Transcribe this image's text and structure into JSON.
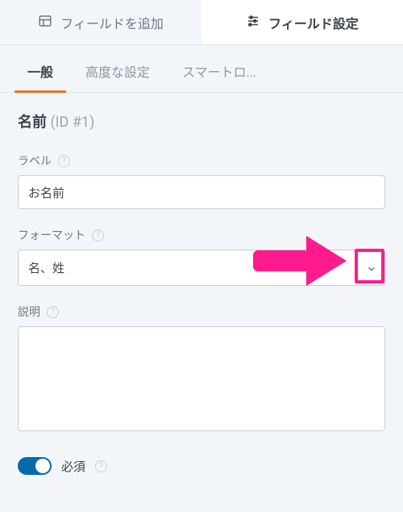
{
  "topTabs": {
    "addField": "フィールドを追加",
    "fieldSettings": "フィールド設定"
  },
  "subTabs": {
    "general": "一般",
    "advanced": "高度な設定",
    "smartLogic": "スマートロ..."
  },
  "field": {
    "title": "名前",
    "idLabel": "(ID #1)"
  },
  "labelSection": {
    "label": "ラベル",
    "value": "お名前"
  },
  "formatSection": {
    "label": "フォーマット",
    "value": "名、姓"
  },
  "descriptionSection": {
    "label": "説明",
    "value": ""
  },
  "requiredSection": {
    "label": "必須"
  },
  "colors": {
    "accent": "#e27730",
    "callout": "#ff1b8d",
    "toggleOn": "#036aab"
  }
}
